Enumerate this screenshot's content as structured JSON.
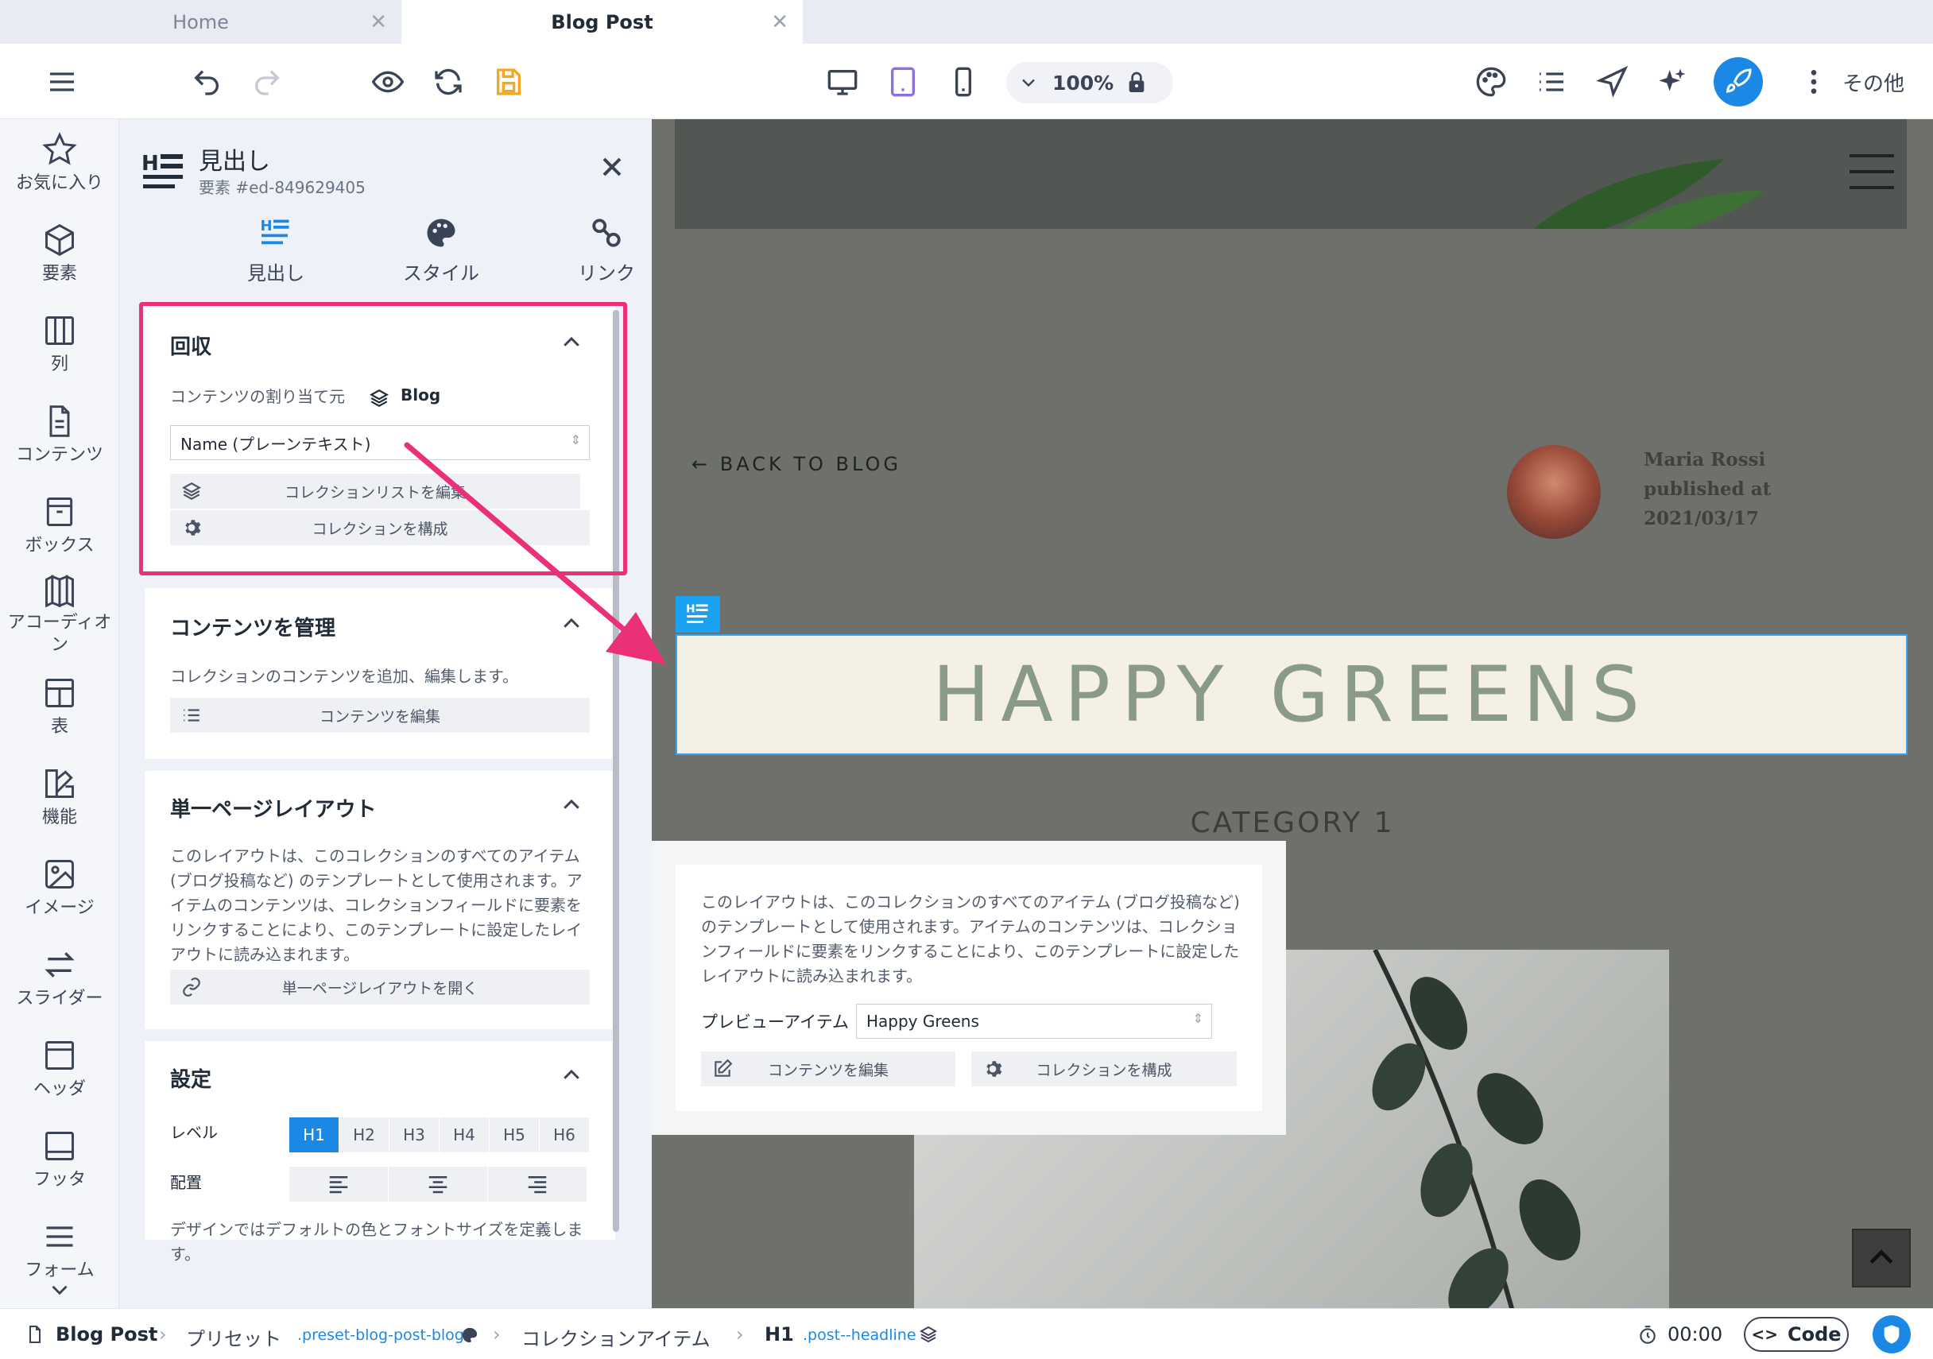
{
  "tabs": [
    {
      "label": "Home"
    },
    {
      "label": "Blog Post"
    }
  ],
  "toolbar": {
    "zoom": "100%",
    "more_label": "その他"
  },
  "sidebar": {
    "items": [
      "お気に入り",
      "要素",
      "列",
      "コンテンツ",
      "ボックス",
      "アコーディオン",
      "表",
      "機能",
      "イメージ",
      "スライダー",
      "ヘッダ",
      "フッタ",
      "フォーム"
    ]
  },
  "panel": {
    "title": "見出し",
    "subtitle": "要素 #ed-849629405",
    "tabs": [
      "見出し",
      "スタイル",
      "リンク"
    ],
    "retrieve": {
      "heading": "回収",
      "source_label": "コンテンツの割り当て元",
      "source_value": "Blog",
      "field_value": "Name (プレーンテキスト)",
      "edit_list": "コレクションリストを編集",
      "configure": "コレクションを構成"
    },
    "manage": {
      "heading": "コンテンツを管理",
      "desc": "コレクションのコンテンツを追加、編集します。",
      "edit": "コンテンツを編集"
    },
    "single": {
      "heading": "単一ページレイアウト",
      "desc": "このレイアウトは、このコレクションのすべてのアイテム (ブログ投稿など) のテンプレートとして使用されます。アイテムのコンテンツは、コレクションフィールドに要素をリンクすることにより、このテンプレートに設定したレイアウトに読み込まれます。",
      "open": "単一ページレイアウトを開く"
    },
    "settings": {
      "heading": "設定",
      "level_label": "レベル",
      "levels": [
        "H1",
        "H2",
        "H3",
        "H4",
        "H5",
        "H6"
      ],
      "selected_level": "H1",
      "align_label": "配置",
      "note": "デザインではデフォルトの色とフォントサイズを定義します。"
    }
  },
  "canvas": {
    "back": "← BACK TO BLOG",
    "author_lines": [
      "Maria Rossi",
      "published at",
      "2021/03/17"
    ],
    "headline": "HAPPY GREENS",
    "category": "CATEGORY 1",
    "popover": {
      "desc": "このレイアウトは、このコレクションのすべてのアイテム (ブログ投稿など) のテンプレートとして使用されます。アイテムのコンテンツは、コレクションフィールドに要素をリンクすることにより、このテンプレートに設定したレイアウトに読み込まれます。",
      "preview_label": "プレビューアイテム",
      "preview_value": "Happy Greens",
      "edit": "コンテンツを編集",
      "configure": "コレクションを構成"
    }
  },
  "status": {
    "page": "Blog Post",
    "preset": "プリセット",
    "preset_class": ".preset-blog-post-blog",
    "collection": "コレクションアイテム",
    "element": "H1",
    "element_class": ".post--headline",
    "time": "00:00",
    "code": "Code"
  },
  "colors": {
    "accent": "#1c88e5",
    "highlight": "#ec2f79",
    "save": "#f5a623",
    "tablet_active": "#8b6fe0"
  }
}
